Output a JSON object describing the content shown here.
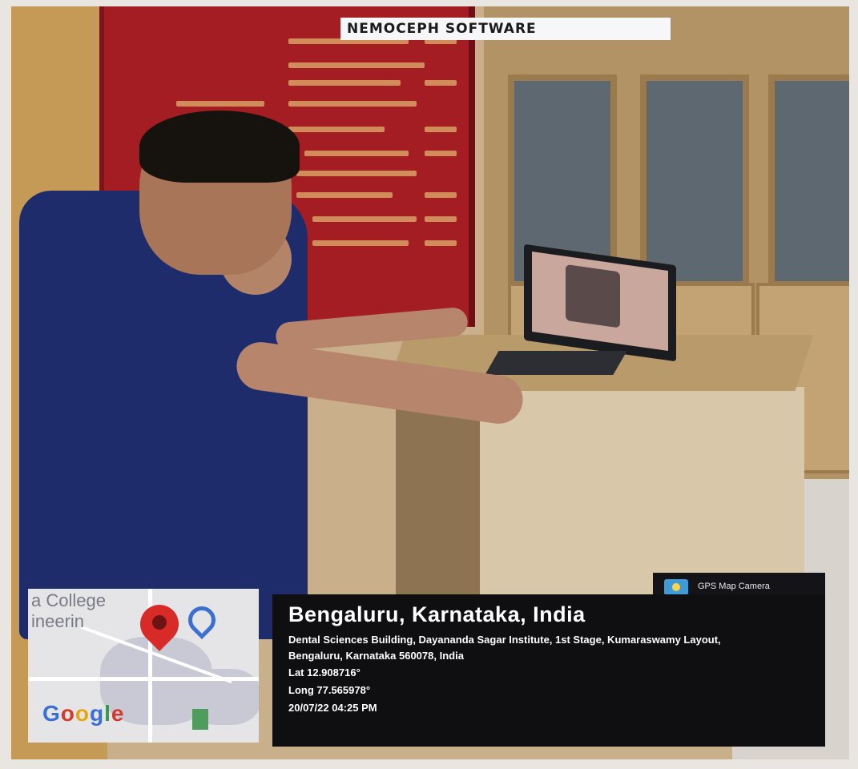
{
  "caption": {
    "title": "NEMOCEPH SOFTWARE"
  },
  "map": {
    "partial_text": "a College\nineerin",
    "google_logo": [
      "G",
      "o",
      "o",
      "g",
      "l",
      "e"
    ],
    "pin_icon": "map-pin-icon",
    "navigation_icon": "navigation-arrow-icon",
    "layers_icon": "layers-icon"
  },
  "gps_badge": {
    "label": "GPS Map Camera",
    "icon": "gps-map-camera-icon"
  },
  "location": {
    "city": "Bengaluru, Karnataka, India",
    "address": "Dental Sciences Building, Dayananda Sagar Institute, 1st Stage, Kumaraswamy Layout, Bengaluru, Karnataka 560078, India",
    "lat": "Lat 12.908716°",
    "long": "Long 77.565978°",
    "datetime": "20/07/22 04:25 PM"
  },
  "colors": {
    "board_red": "#a41d22",
    "scrub_blue": "#1e2c6b",
    "panel_black": "#0f0f12",
    "pin_red": "#d82a26"
  }
}
